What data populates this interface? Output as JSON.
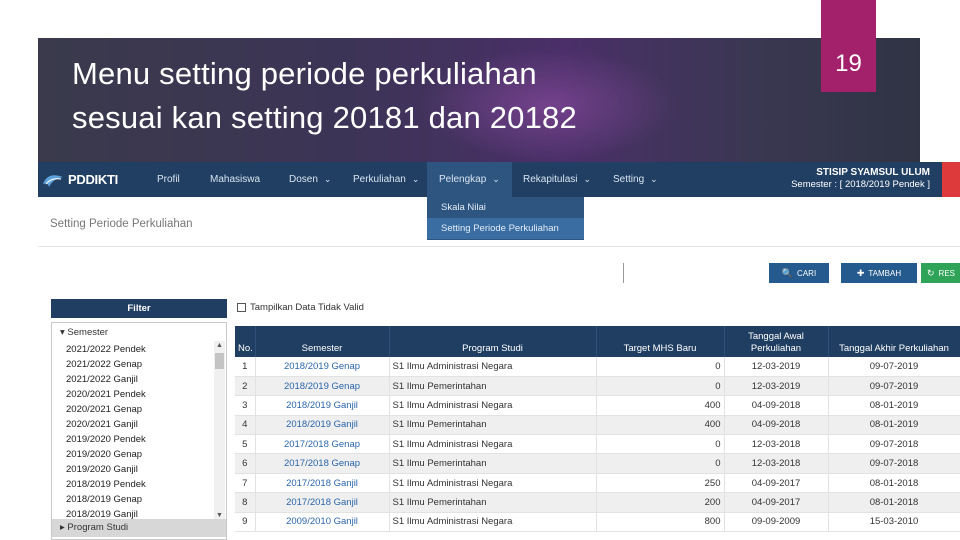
{
  "slide": {
    "title_lines": [
      "Menu setting periode perkuliahan",
      "sesuai kan setting 20181 dan 20182"
    ],
    "page_number": "19"
  },
  "app": {
    "brand": "PDDIKTI",
    "nav": [
      {
        "label": "Profil",
        "has_dropdown": false
      },
      {
        "label": "Mahasiswa",
        "has_dropdown": false
      },
      {
        "label": "Dosen",
        "has_dropdown": true
      },
      {
        "label": "Perkuliahan",
        "has_dropdown": true
      },
      {
        "label": "Pelengkap",
        "has_dropdown": true,
        "active": true
      },
      {
        "label": "Rekapitulasi",
        "has_dropdown": true
      },
      {
        "label": "Setting",
        "has_dropdown": true
      }
    ],
    "chevron": "⌄",
    "institution": "STISIP SYAMSUL ULUM",
    "semester_info": "Semester : [ 2018/2019 Pendek ]",
    "dropdown": [
      "Skala Nilai",
      "Setting Periode Perkuliahan"
    ],
    "page_heading": "Setting Periode Perkuliahan",
    "buttons": {
      "cari": "CARI",
      "tambah": "TAMBAH",
      "reset": "RES"
    },
    "filter": {
      "title": "Filter",
      "semester_group": "Semester",
      "semesters": [
        "2021/2022 Pendek",
        "2021/2022 Genap",
        "2021/2022 Ganjil",
        "2020/2021 Pendek",
        "2020/2021 Genap",
        "2020/2021 Ganjil",
        "2019/2020 Pendek",
        "2019/2020 Genap",
        "2019/2020 Ganjil",
        "2018/2019 Pendek",
        "2018/2019 Genap",
        "2018/2019 Ganjil"
      ],
      "prodi_group": "Program Studi"
    },
    "table": {
      "checkbox_label": "Tampilkan Data Tidak Valid",
      "headers": [
        "No.",
        "Semester",
        "Program Studi",
        "Target MHS Baru",
        "Tanggal Awal Perkuliahan",
        "Tanggal Akhir Perkuliahan"
      ],
      "rows": [
        [
          "1",
          "2018/2019 Genap",
          "S1 Ilmu Administrasi Negara",
          "0",
          "12-03-2019",
          "09-07-2019"
        ],
        [
          "2",
          "2018/2019 Genap",
          "S1 Ilmu Pemerintahan",
          "0",
          "12-03-2019",
          "09-07-2019"
        ],
        [
          "3",
          "2018/2019 Ganjil",
          "S1 Ilmu Administrasi Negara",
          "400",
          "04-09-2018",
          "08-01-2019"
        ],
        [
          "4",
          "2018/2019 Ganjil",
          "S1 Ilmu Pemerintahan",
          "400",
          "04-09-2018",
          "08-01-2019"
        ],
        [
          "5",
          "2017/2018 Genap",
          "S1 Ilmu Administrasi Negara",
          "0",
          "12-03-2018",
          "09-07-2018"
        ],
        [
          "6",
          "2017/2018 Genap",
          "S1 Ilmu Pemerintahan",
          "0",
          "12-03-2018",
          "09-07-2018"
        ],
        [
          "7",
          "2017/2018 Ganjil",
          "S1 Ilmu Administrasi Negara",
          "250",
          "04-09-2017",
          "08-01-2018"
        ],
        [
          "8",
          "2017/2018 Ganjil",
          "S1 Ilmu Pemerintahan",
          "200",
          "04-09-2017",
          "08-01-2018"
        ],
        [
          "9",
          "2009/2010 Ganjil",
          "S1 Ilmu Administrasi Negara",
          "800",
          "09-09-2009",
          "15-03-2010"
        ]
      ]
    }
  }
}
